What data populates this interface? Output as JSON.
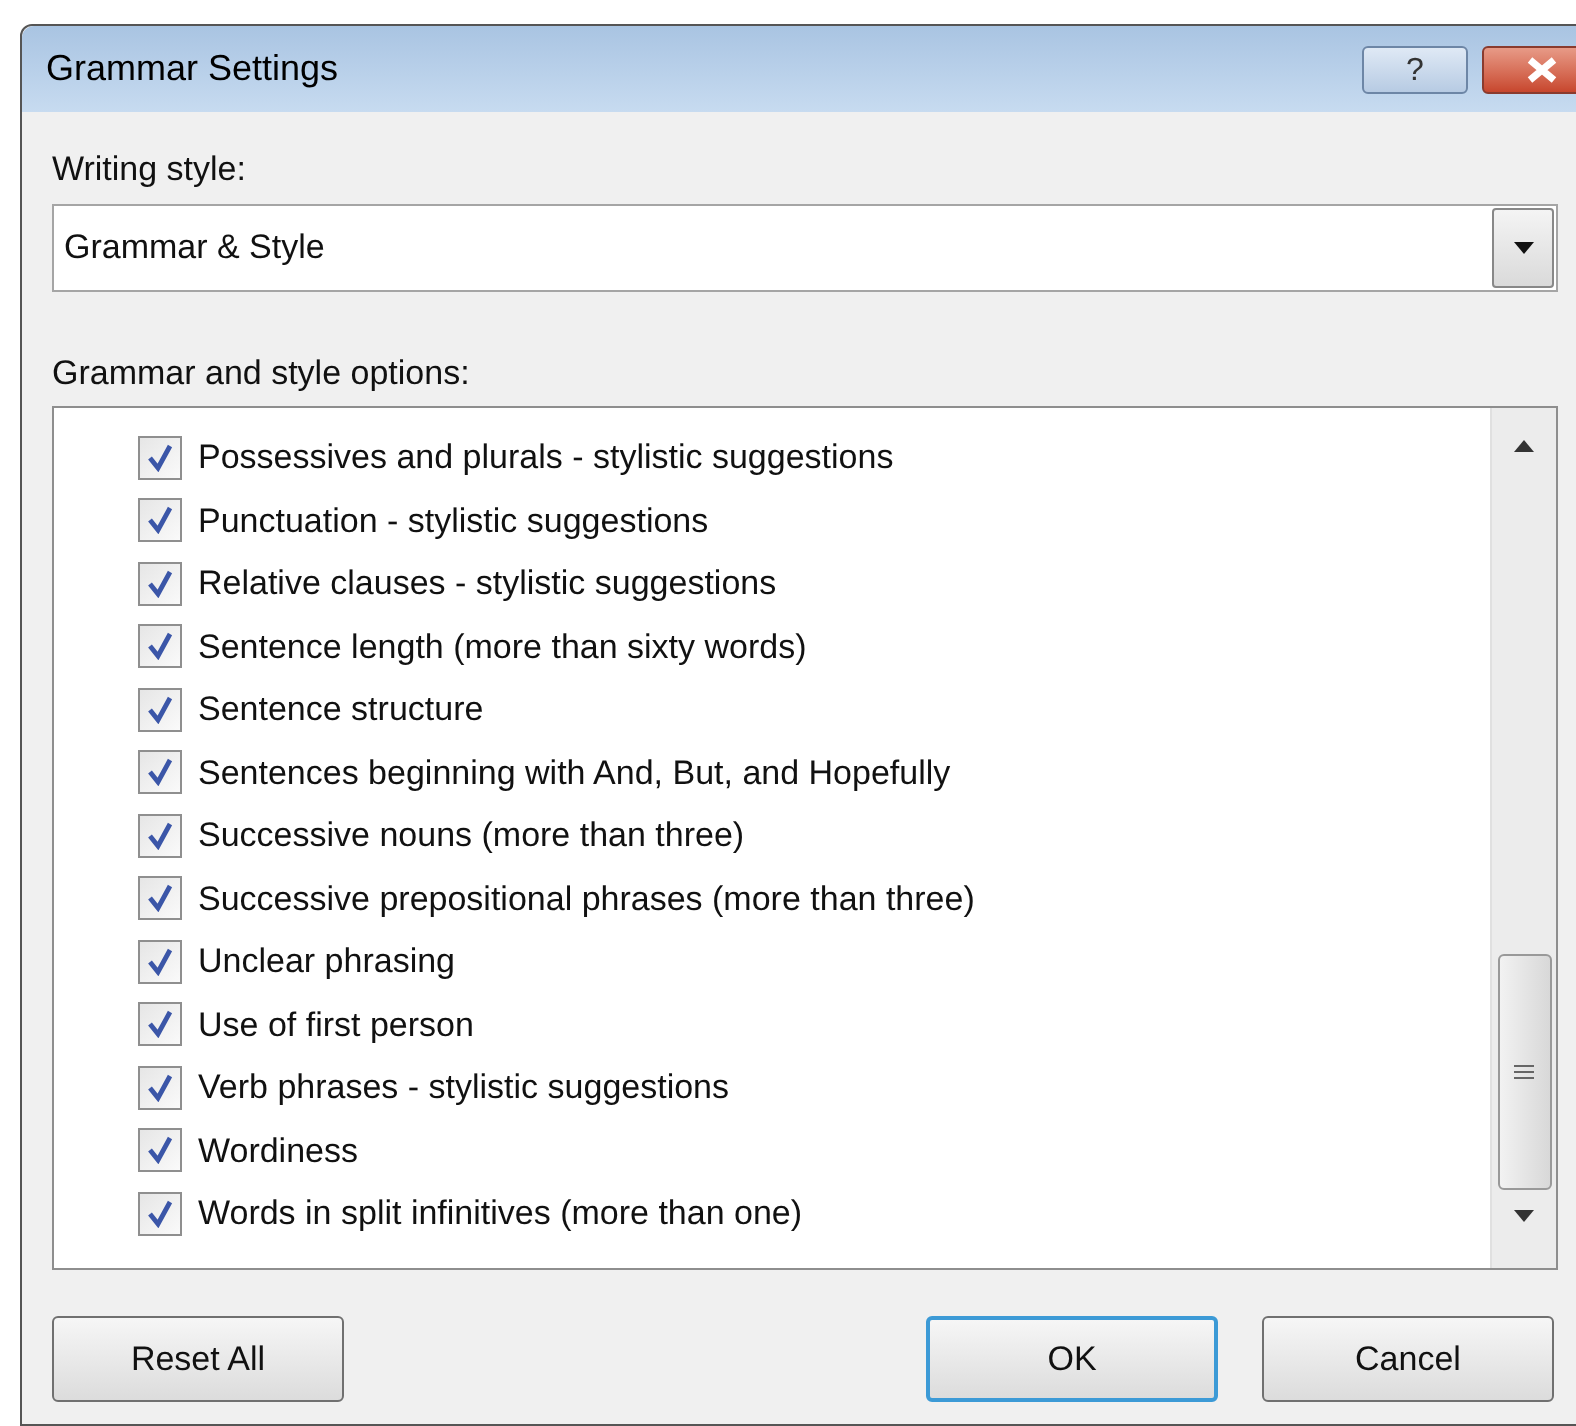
{
  "window": {
    "title": "Grammar Settings",
    "help_button": "?"
  },
  "writing_style": {
    "label": "Writing style:",
    "value": "Grammar & Style"
  },
  "options": {
    "label": "Grammar and style options:",
    "items": [
      {
        "label": "Possessives and plurals - stylistic suggestions",
        "checked": true
      },
      {
        "label": "Punctuation - stylistic suggestions",
        "checked": true
      },
      {
        "label": "Relative clauses - stylistic suggestions",
        "checked": true
      },
      {
        "label": "Sentence length (more than sixty words)",
        "checked": true
      },
      {
        "label": "Sentence structure",
        "checked": true
      },
      {
        "label": "Sentences beginning with And, But, and Hopefully",
        "checked": true
      },
      {
        "label": "Successive nouns (more than three)",
        "checked": true
      },
      {
        "label": "Successive prepositional phrases (more than three)",
        "checked": true
      },
      {
        "label": "Unclear phrasing",
        "checked": true
      },
      {
        "label": "Use of first person",
        "checked": true
      },
      {
        "label": "Verb phrases - stylistic suggestions",
        "checked": true
      },
      {
        "label": "Wordiness",
        "checked": true
      },
      {
        "label": "Words in split infinitives (more than one)",
        "checked": true
      }
    ]
  },
  "buttons": [
    {
      "label": "Reset All",
      "kind": "left",
      "default": false
    },
    {
      "label": "OK",
      "kind": "right",
      "default": true
    },
    {
      "label": "Cancel",
      "kind": "right",
      "default": false
    }
  ]
}
